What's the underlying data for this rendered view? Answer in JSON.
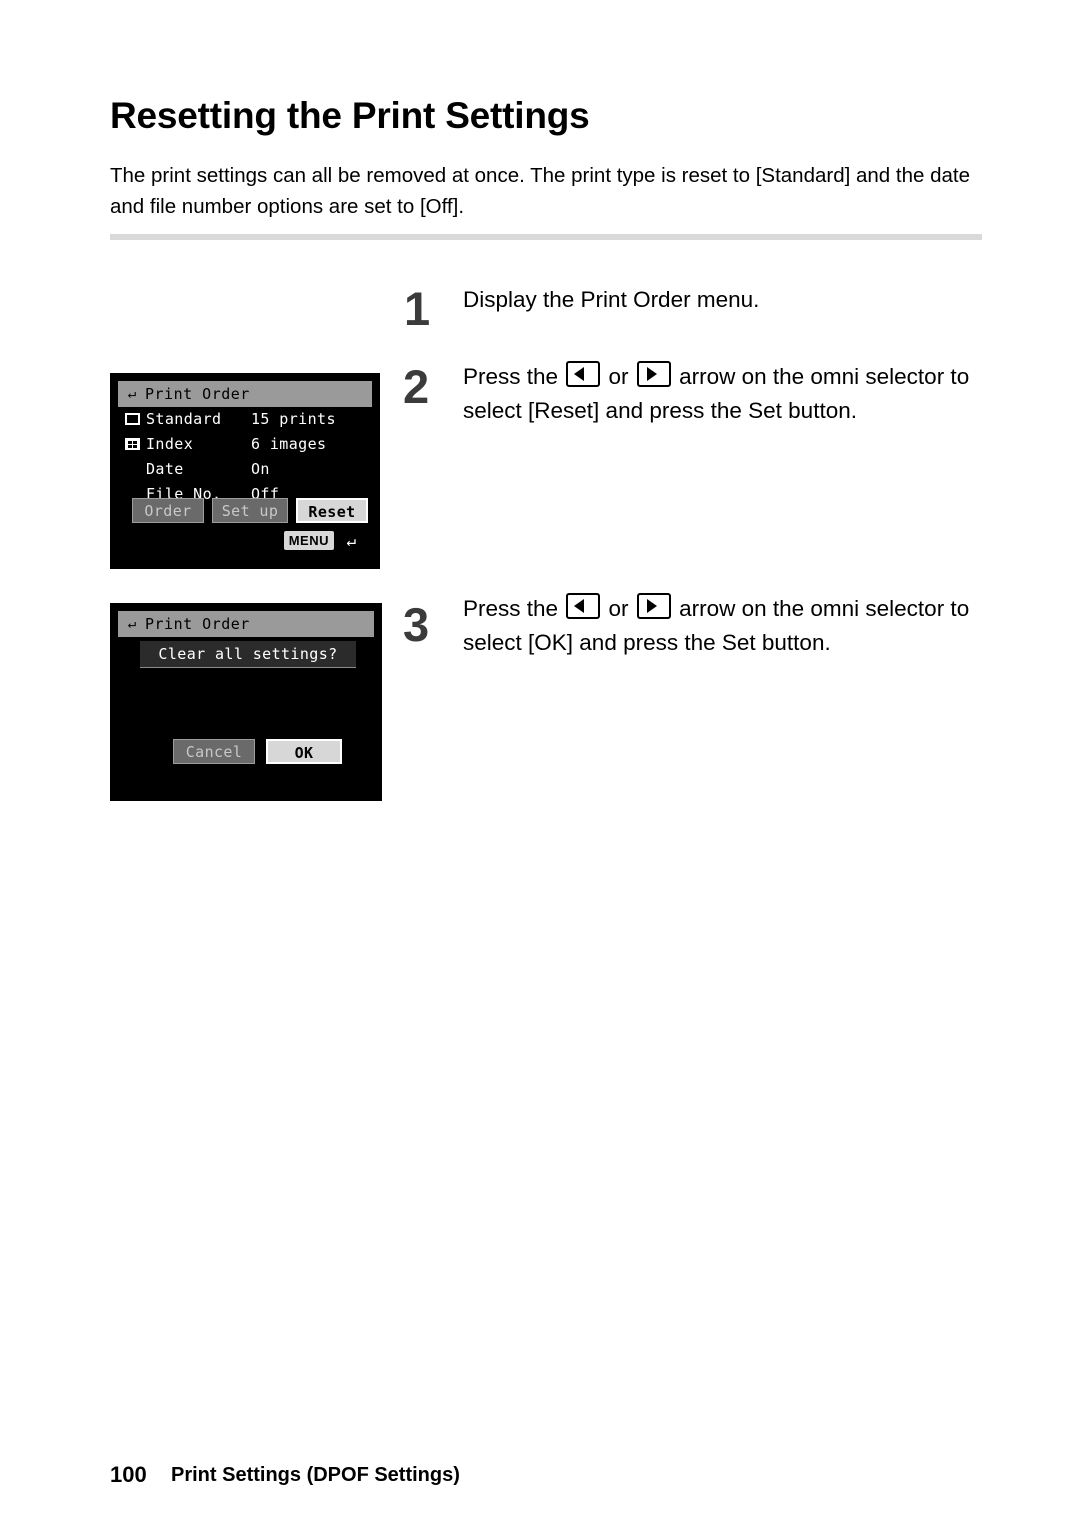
{
  "page": {
    "title": "Resetting the Print Settings",
    "intro": "The print settings can all be removed at once. The print type is reset to [Standard] and the date and file number options are set to [Off].",
    "footer_number": "100",
    "footer_text": "Print Settings (DPOF Settings)"
  },
  "steps": [
    {
      "number": "1",
      "text_before": "Display the Print Order menu.",
      "text_mid": "",
      "text_after": ""
    },
    {
      "number": "2",
      "text_before": "Press the ",
      "text_mid": " or ",
      "text_after": " arrow on the omni selector to select [Reset] and press the Set button."
    },
    {
      "number": "3",
      "text_before": "Press the ",
      "text_mid": " or ",
      "text_after": " arrow on the omni selector to select [OK] and press the Set button."
    }
  ],
  "lcd_print_order": {
    "title": "Print Order",
    "rows": [
      {
        "label": "Standard",
        "value": "15 prints",
        "icon": "standard-print-icon"
      },
      {
        "label": "Index",
        "value": "6 images",
        "icon": "index-print-icon"
      },
      {
        "label": "Date",
        "value": "On",
        "icon": ""
      },
      {
        "label": "File No.",
        "value": "Off",
        "icon": ""
      }
    ],
    "buttons": [
      {
        "label": "Order",
        "state": "dim"
      },
      {
        "label": "Set up",
        "state": "dim"
      },
      {
        "label": "Reset",
        "state": "selected"
      }
    ],
    "menu_badge": "MENU"
  },
  "lcd_clear_dialog": {
    "title": "Print Order",
    "question": "Clear all settings?",
    "buttons": [
      {
        "label": "Cancel",
        "state": "dim"
      },
      {
        "label": "OK",
        "state": "selected"
      }
    ]
  },
  "colors": {
    "lcd_background": "#000000",
    "lcd_titlebar": "#9a9a9a",
    "button_selected": "#d7d7d7",
    "button_dim": "#6a6a6a",
    "rule": "#d9d9d9",
    "step_number": "#3b3b3b"
  }
}
